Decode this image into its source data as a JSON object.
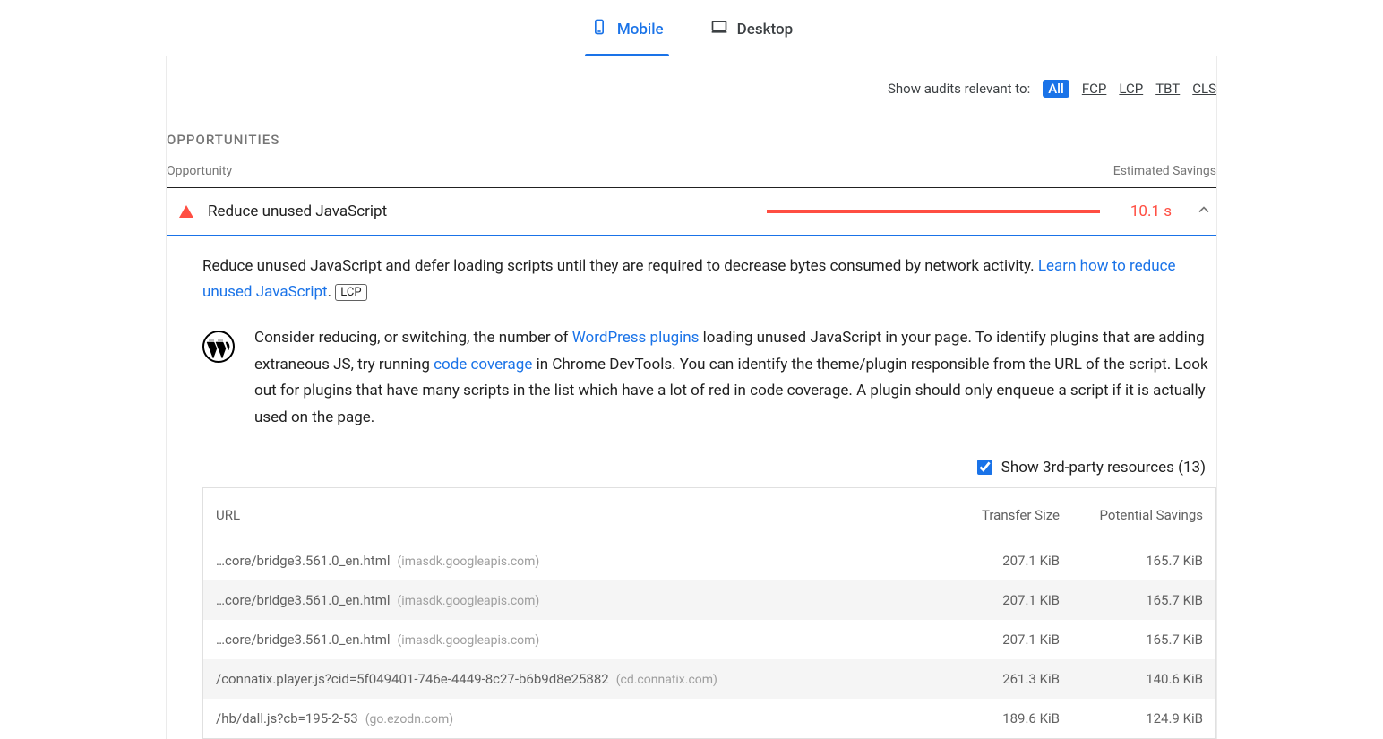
{
  "tabs": {
    "mobile": "Mobile",
    "desktop": "Desktop"
  },
  "filters": {
    "label": "Show audits relevant to:",
    "all": "All",
    "fcp": "FCP",
    "lcp": "LCP",
    "tbt": "TBT",
    "cls": "CLS"
  },
  "section_title": "OPPORTUNITIES",
  "header": {
    "left": "Opportunity",
    "right": "Estimated Savings"
  },
  "opp": {
    "name": "Reduce unused JavaScript",
    "savings": "10.1 s"
  },
  "desc": {
    "part1": "Reduce unused JavaScript and defer loading scripts until they are required to decrease bytes consumed by network activity. ",
    "link": "Learn how to reduce unused JavaScript",
    "part2": ".",
    "badge": "LCP"
  },
  "wp": {
    "part1": "Consider reducing, or switching, the number of ",
    "link1": "WordPress plugins",
    "part2": " loading unused JavaScript in your page. To identify plugins that are adding extraneous JS, try running ",
    "link2": "code coverage",
    "part3": " in Chrome DevTools. You can identify the theme/plugin responsible from the URL of the script. Look out for plugins that have many scripts in the list which have a lot of red in code coverage. A plugin should only enqueue a script if it is actually used on the page."
  },
  "thirdparty": {
    "label": "Show 3rd-party resources (13)"
  },
  "table": {
    "cols": {
      "url": "URL",
      "transfer": "Transfer Size",
      "savings": "Potential Savings"
    },
    "rows": [
      {
        "path": "…core/bridge3.561.0_en.html",
        "host": "(imasdk.googleapis.com)",
        "transfer": "207.1 KiB",
        "savings": "165.7 KiB"
      },
      {
        "path": "…core/bridge3.561.0_en.html",
        "host": "(imasdk.googleapis.com)",
        "transfer": "207.1 KiB",
        "savings": "165.7 KiB"
      },
      {
        "path": "…core/bridge3.561.0_en.html",
        "host": "(imasdk.googleapis.com)",
        "transfer": "207.1 KiB",
        "savings": "165.7 KiB"
      },
      {
        "path": "/connatix.player.js?cid=5f049401-746e-4449-8c27-b6b9d8e25882",
        "host": "(cd.connatix.com)",
        "transfer": "261.3 KiB",
        "savings": "140.6 KiB"
      },
      {
        "path": "/hb/dall.js?cb=195-2-53",
        "host": "(go.ezodn.com)",
        "transfer": "189.6 KiB",
        "savings": "124.9 KiB"
      }
    ]
  }
}
